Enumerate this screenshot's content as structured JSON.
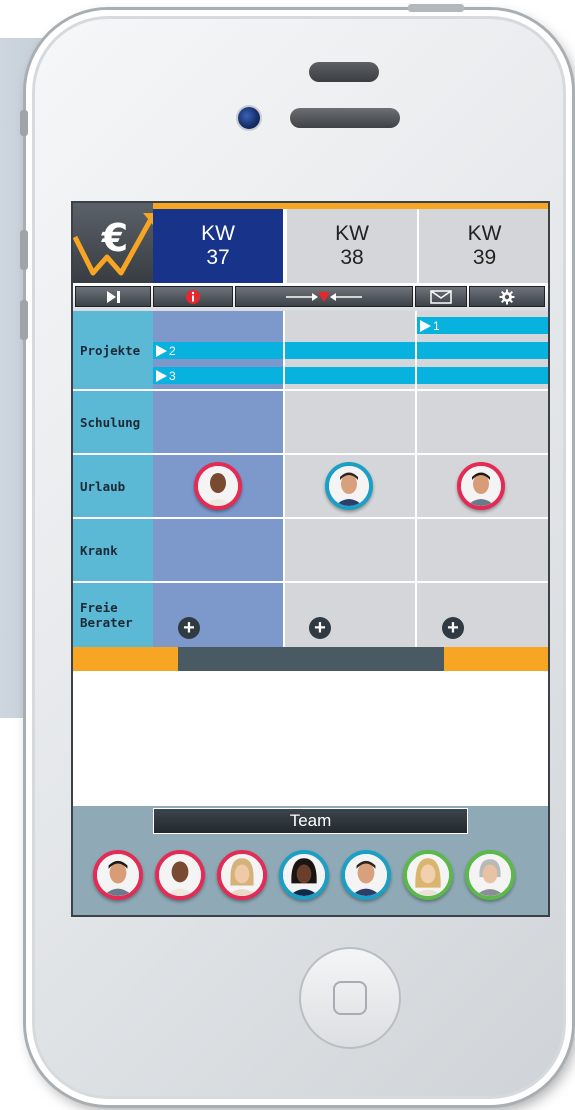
{
  "header": {
    "logo_symbol": "€",
    "weeks": [
      {
        "label": "KW",
        "number": "37",
        "active": true
      },
      {
        "label": "KW",
        "number": "38",
        "active": false
      },
      {
        "label": "KW",
        "number": "39",
        "active": false
      }
    ]
  },
  "toolbar": {
    "icons": [
      "skip-to-end-icon",
      "info-icon",
      "zoom-in-arrows-icon",
      "mail-icon",
      "gear-icon"
    ]
  },
  "rows": {
    "projects": "Projekte",
    "training": "Schulung",
    "vacation": "Urlaub",
    "sick": "Krank",
    "free_line1": "Freie",
    "free_line2": "Berater"
  },
  "projects": [
    {
      "id": "1"
    },
    {
      "id": "2"
    },
    {
      "id": "3"
    }
  ],
  "team": {
    "label": "Team"
  },
  "colors": {
    "active_week": "#17348a",
    "accent_orange": "#f7a623",
    "label_blue": "#5bb9d6",
    "project_bar": "#08b2de",
    "ring_red": "#e32b55",
    "ring_teal": "#1b9fc4",
    "ring_green": "#5cb84a"
  }
}
